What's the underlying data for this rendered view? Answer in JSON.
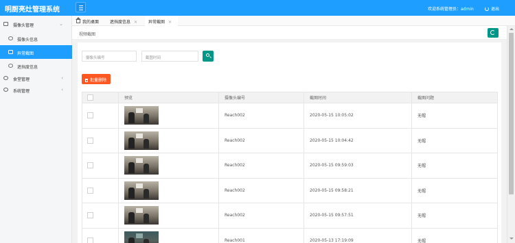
{
  "header": {
    "app_title": "明厨亮灶管理系统",
    "welcome_text": "欢迎系统管理员：admin",
    "logout_label": "退出"
  },
  "sidebar": {
    "groups": [
      {
        "label": "摄像头管理",
        "icon": "video-icon",
        "expanded": true,
        "items": [
          {
            "label": "摄像头信息",
            "icon": "eye-icon"
          },
          {
            "label": "异常截图",
            "icon": "image-icon",
            "active": true
          },
          {
            "label": "遮挡度信息",
            "icon": "hand-icon"
          }
        ]
      },
      {
        "label": "食堂管理",
        "icon": "user-icon",
        "expanded": false
      },
      {
        "label": "系统管理",
        "icon": "gear-icon",
        "expanded": false
      }
    ]
  },
  "tabs": [
    {
      "label": "我的桌面",
      "icon": "home-icon"
    },
    {
      "label": "遮挡度信息",
      "closable": true
    },
    {
      "label": "异常截图",
      "closable": true,
      "active": true
    }
  ],
  "breadcrumb": "视频截图",
  "search": {
    "camera_placeholder": "摄像头编号",
    "time_placeholder": "截图时间"
  },
  "batch_delete_label": "批量删除",
  "table": {
    "columns": [
      "预览",
      "摄像头编号",
      "截图时间",
      "截图问题"
    ],
    "rows": [
      {
        "camera": "Reach002",
        "time": "2020-05-15 10:05:02",
        "issue": "无帽"
      },
      {
        "camera": "Reach002",
        "time": "2020-05-15 10:04:42",
        "issue": "无帽"
      },
      {
        "camera": "Reach002",
        "time": "2020-05-15 09:59:03",
        "issue": "无帽"
      },
      {
        "camera": "Reach002",
        "time": "2020-05-15 09:58:21",
        "issue": "无帽"
      },
      {
        "camera": "Reach002",
        "time": "2020-05-15 09:57:51",
        "issue": "无帽"
      },
      {
        "camera": "Reach001",
        "time": "2020-05-13 17:19:09",
        "issue": "无帽"
      }
    ]
  },
  "colors": {
    "header_blue": "#1e9fff",
    "active_item": "#1e9fff",
    "primary_green": "#009688",
    "danger_orange": "#ff5722"
  }
}
